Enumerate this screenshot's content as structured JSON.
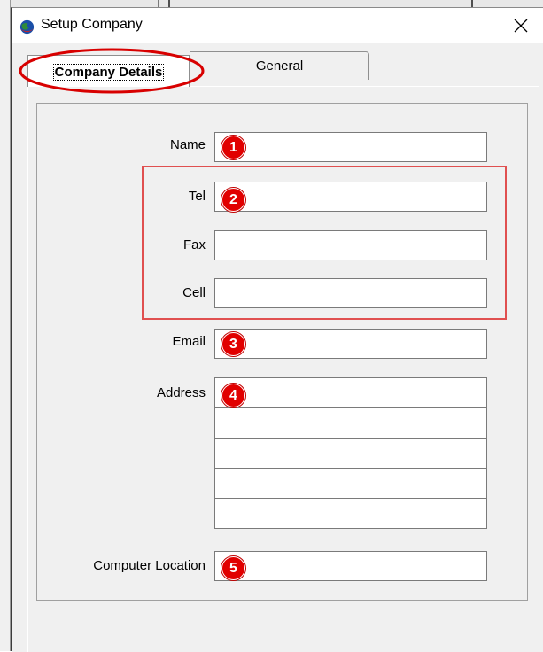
{
  "dialog": {
    "title": "Setup Company",
    "close_glyph": "×"
  },
  "tabs": [
    {
      "label": "Company Details",
      "active": true
    },
    {
      "label": "General",
      "active": false
    }
  ],
  "form": {
    "name": {
      "label": "Name",
      "value": "",
      "badge": "1"
    },
    "tel": {
      "label": "Tel",
      "value": "",
      "badge": "2"
    },
    "fax": {
      "label": "Fax",
      "value": ""
    },
    "cell": {
      "label": "Cell",
      "value": ""
    },
    "email": {
      "label": "Email",
      "value": "",
      "badge": "3"
    },
    "address": {
      "label": "Address",
      "lines": [
        "",
        "",
        "",
        "",
        ""
      ],
      "badge": "4"
    },
    "computer_location": {
      "label": "Computer Location",
      "value": "",
      "badge": "5"
    }
  },
  "colors": {
    "annotation_red": "#e10000",
    "highlight_box": "#e05050",
    "ellipse": "#d80000",
    "dialog_bg": "#f0f0f0"
  },
  "icons": {
    "app": "globe-app-icon",
    "close": "close-icon"
  }
}
